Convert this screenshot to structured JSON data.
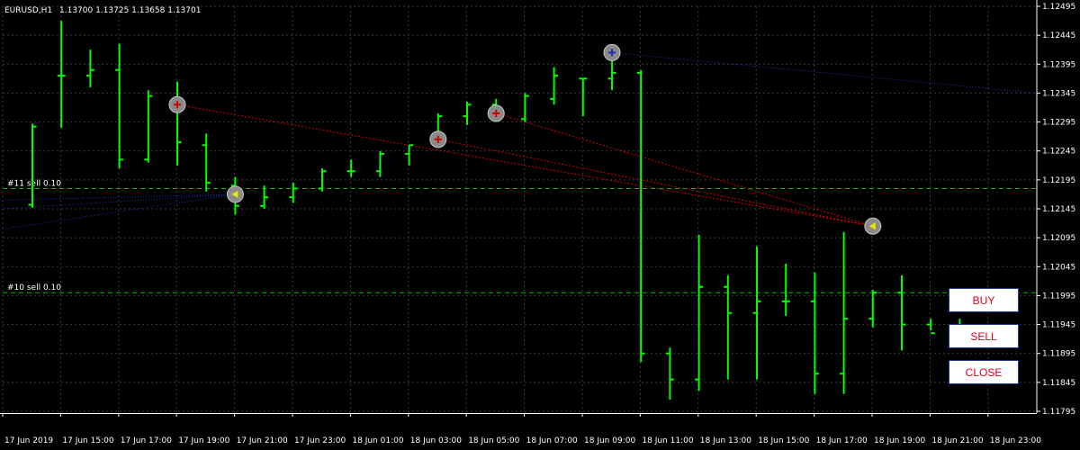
{
  "header": {
    "symbol_timeframe": "EURUSD,H1",
    "ohlc": "1.13700 1.13725 1.13658 1.13701"
  },
  "order_lines": [
    {
      "label": "#11 sell 0.10",
      "price": 1.1218
    },
    {
      "label": "#10 sell 0.10",
      "price": 1.12
    }
  ],
  "buttons": {
    "buy": "BUY",
    "sell": "SELL",
    "close": "CLOSE"
  },
  "colors": {
    "background": "#000000",
    "grid": "#3a3a3a",
    "bars": "#00ff00",
    "axis": "#ffffff",
    "order_line": "#00c000",
    "trade_blue": "#1e2eb8",
    "trade_red": "#d00000",
    "button_text": "#e0001a"
  },
  "chart_data": {
    "type": "ohlc",
    "symbol": "EURUSD",
    "timeframe": "H1",
    "ylim": [
      1.11795,
      1.12495
    ],
    "y_ticks": [
      1.12495,
      1.12445,
      1.12395,
      1.12345,
      1.12295,
      1.12245,
      1.12195,
      1.12145,
      1.12095,
      1.12045,
      1.11995,
      1.11945,
      1.11895,
      1.11845,
      1.11795
    ],
    "y_tick_labels": [
      "1.12495",
      "1.12445",
      "1.12395",
      "1.12345",
      "1.12295",
      "1.12245",
      "1.12195",
      "1.12145",
      "1.12095",
      "1.12045",
      "1.11995",
      "1.11945",
      "1.11895",
      "1.11845",
      "1.11795"
    ],
    "x_labels": [
      "17 Jun 2019",
      "17 Jun 15:00",
      "17 Jun 17:00",
      "17 Jun 19:00",
      "17 Jun 21:00",
      "17 Jun 23:00",
      "18 Jun 01:00",
      "18 Jun 03:00",
      "18 Jun 05:00",
      "18 Jun 07:00",
      "18 Jun 09:00",
      "18 Jun 11:00",
      "18 Jun 13:00",
      "18 Jun 15:00",
      "18 Jun 17:00",
      "18 Jun 19:00",
      "18 Jun 21:00",
      "18 Jun 23:00"
    ],
    "bars": [
      {
        "o": 1.12152,
        "h": 1.12292,
        "l": 1.12147,
        "c": 1.12287
      },
      {
        "o": 1.12375,
        "h": 1.1247,
        "l": 1.12285,
        "c": 1.12375
      },
      {
        "o": 1.12375,
        "h": 1.1242,
        "l": 1.12355,
        "c": 1.12385
      },
      {
        "o": 1.12385,
        "h": 1.1243,
        "l": 1.12215,
        "c": 1.1223
      },
      {
        "o": 1.1223,
        "h": 1.1235,
        "l": 1.12225,
        "c": 1.1234
      },
      {
        "o": 1.1232,
        "h": 1.12365,
        "l": 1.1222,
        "c": 1.1226
      },
      {
        "o": 1.12255,
        "h": 1.12275,
        "l": 1.12175,
        "c": 1.1219
      },
      {
        "o": 1.12185,
        "h": 1.122,
        "l": 1.12135,
        "c": 1.1215
      },
      {
        "o": 1.1215,
        "h": 1.12185,
        "l": 1.12145,
        "c": 1.12165
      },
      {
        "o": 1.12165,
        "h": 1.1219,
        "l": 1.12155,
        "c": 1.1218
      },
      {
        "o": 1.1218,
        "h": 1.12215,
        "l": 1.12175,
        "c": 1.1221
      },
      {
        "o": 1.1221,
        "h": 1.1223,
        "l": 1.122,
        "c": 1.1221
      },
      {
        "o": 1.1221,
        "h": 1.12245,
        "l": 1.122,
        "c": 1.1224
      },
      {
        "o": 1.1224,
        "h": 1.12255,
        "l": 1.1222,
        "c": 1.12255
      },
      {
        "o": 1.12255,
        "h": 1.1231,
        "l": 1.1225,
        "c": 1.12305
      },
      {
        "o": 1.12305,
        "h": 1.1233,
        "l": 1.1229,
        "c": 1.12325
      },
      {
        "o": 1.12325,
        "h": 1.12335,
        "l": 1.12295,
        "c": 1.123
      },
      {
        "o": 1.123,
        "h": 1.12345,
        "l": 1.12295,
        "c": 1.1234
      },
      {
        "o": 1.12335,
        "h": 1.1239,
        "l": 1.12325,
        "c": 1.12375
      },
      {
        "o": 1.1237,
        "h": 1.1237,
        "l": 1.12305,
        "c": 1.1237
      },
      {
        "o": 1.1237,
        "h": 1.12425,
        "l": 1.1235,
        "c": 1.1238
      },
      {
        "o": 1.1238,
        "h": 1.12385,
        "l": 1.1188,
        "c": 1.11895
      },
      {
        "o": 1.11895,
        "h": 1.11905,
        "l": 1.11815,
        "c": 1.1185
      },
      {
        "o": 1.1185,
        "h": 1.121,
        "l": 1.1183,
        "c": 1.1201
      },
      {
        "o": 1.1201,
        "h": 1.1203,
        "l": 1.1185,
        "c": 1.11965
      },
      {
        "o": 1.11965,
        "h": 1.1208,
        "l": 1.1185,
        "c": 1.11985
      },
      {
        "o": 1.11985,
        "h": 1.1205,
        "l": 1.1196,
        "c": 1.11985
      },
      {
        "o": 1.11985,
        "h": 1.12035,
        "l": 1.11825,
        "c": 1.1186
      },
      {
        "o": 1.1186,
        "h": 1.12105,
        "l": 1.11825,
        "c": 1.11955
      },
      {
        "o": 1.11955,
        "h": 1.12005,
        "l": 1.1194,
        "c": 1.12
      },
      {
        "o": 1.12,
        "h": 1.1203,
        "l": 1.119,
        "c": 1.11945
      },
      {
        "o": 1.11945,
        "h": 1.11955,
        "l": 1.11935,
        "c": 1.1193
      },
      {
        "o": 1.1193,
        "h": 1.11955,
        "l": 1.1192,
        "c": 1.11935
      },
      {
        "o": 1.11935,
        "h": 1.11945,
        "l": 1.11925,
        "c": 1.11935
      }
    ],
    "trades": [
      {
        "type": "sell",
        "open_bar": 5,
        "open_price": 1.12325,
        "close_bar": 29,
        "close_price": 1.12115
      },
      {
        "type": "sell",
        "open_bar": 14,
        "open_price": 1.12265,
        "close_bar": 29,
        "close_price": 1.12115
      },
      {
        "type": "sell",
        "open_bar": 16,
        "open_price": 1.1231,
        "close_bar": 29,
        "close_price": 1.12115
      },
      {
        "type": "buy",
        "open_bar": 20,
        "open_price": 1.12415,
        "close_bar": null,
        "close_price": null
      }
    ]
  }
}
